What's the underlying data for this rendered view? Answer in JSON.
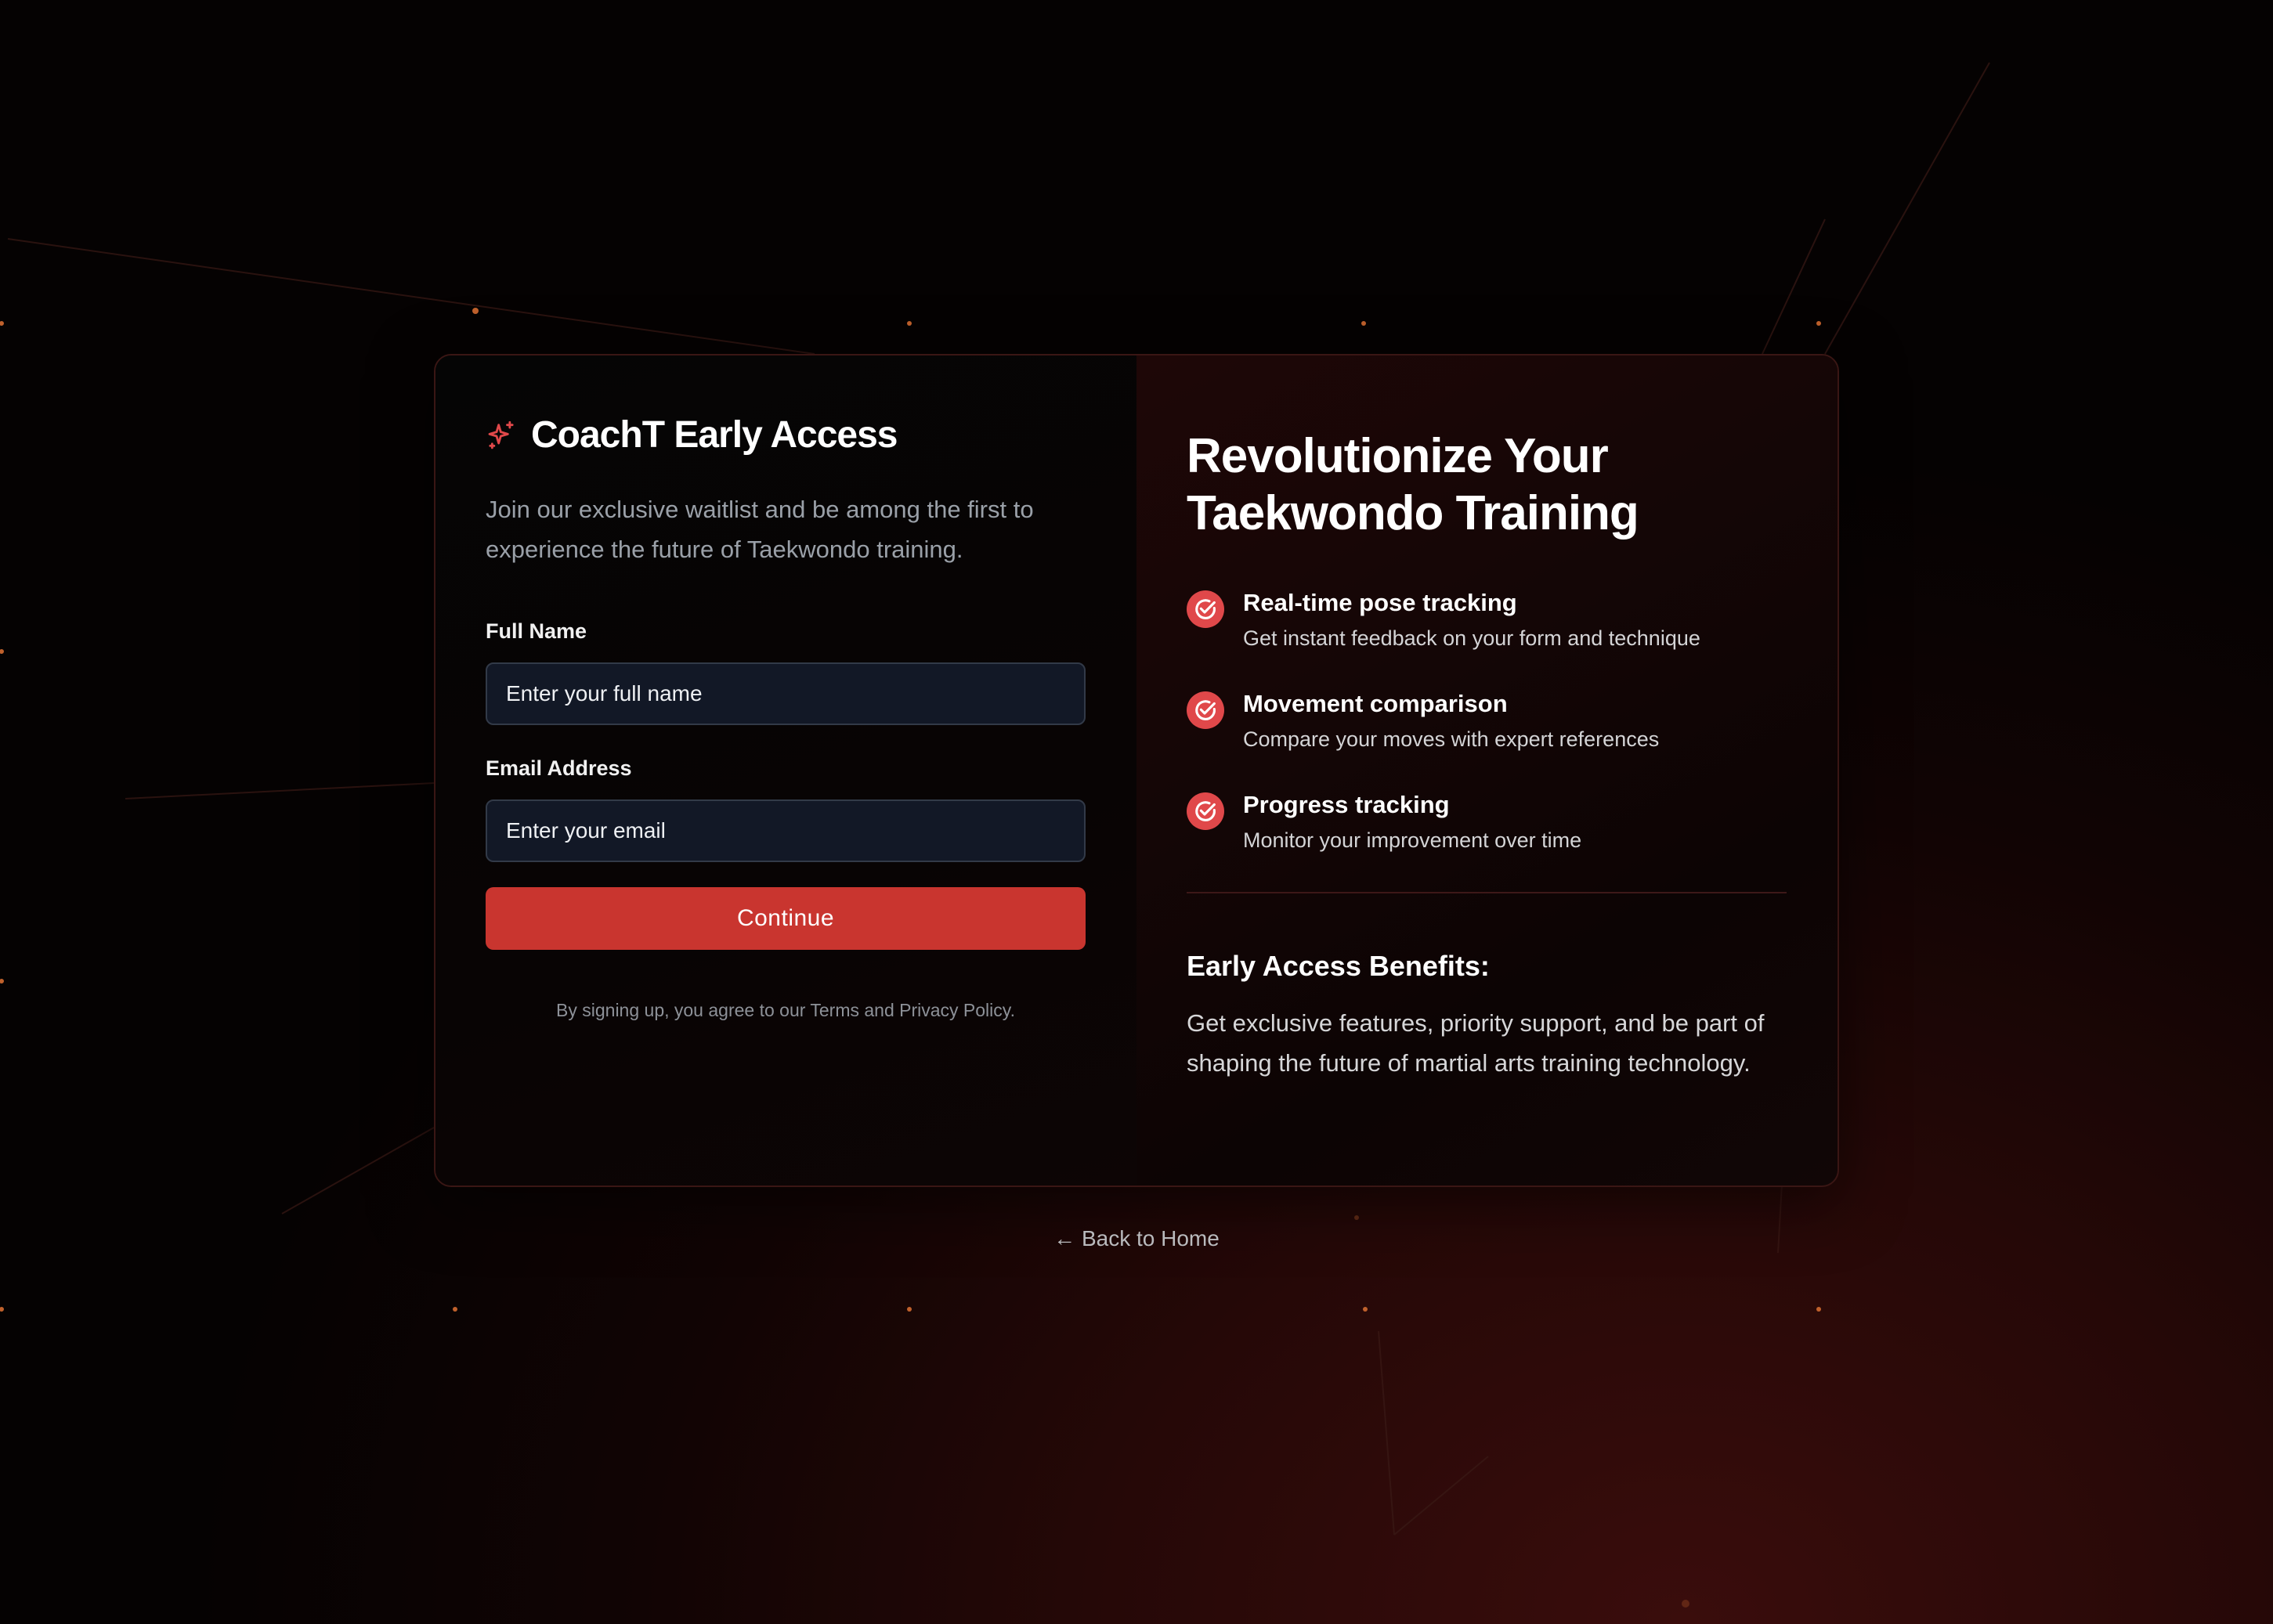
{
  "brand": {
    "icon": "sparkles-icon",
    "title": "CoachT Early Access",
    "accent_color": "#e0484a"
  },
  "form": {
    "intro": "Join our exclusive waitlist and be among the first to experience the future of Taekwondo training.",
    "full_name_label": "Full Name",
    "full_name_placeholder": "Enter your full name",
    "email_label": "Email Address",
    "email_placeholder": "Enter your email",
    "continue_label": "Continue",
    "button_color": "#c9352f",
    "terms": "By signing up, you agree to our Terms and Privacy Policy."
  },
  "promo": {
    "headline_line1": "Revolutionize Your",
    "headline_line2": "Taekwondo Training",
    "features": [
      {
        "icon": "check-circle-icon",
        "title": "Real-time pose tracking",
        "desc": "Get instant feedback on your form and technique"
      },
      {
        "icon": "check-circle-icon",
        "title": "Movement comparison",
        "desc": "Compare your moves with expert references"
      },
      {
        "icon": "check-circle-icon",
        "title": "Progress tracking",
        "desc": "Monitor your improvement over time"
      }
    ],
    "benefits_title": "Early Access Benefits:",
    "benefits_text": "Get exclusive features, priority support, and be part of shaping the future of martial arts training technology."
  },
  "nav": {
    "back_label": "← Back to Home"
  }
}
